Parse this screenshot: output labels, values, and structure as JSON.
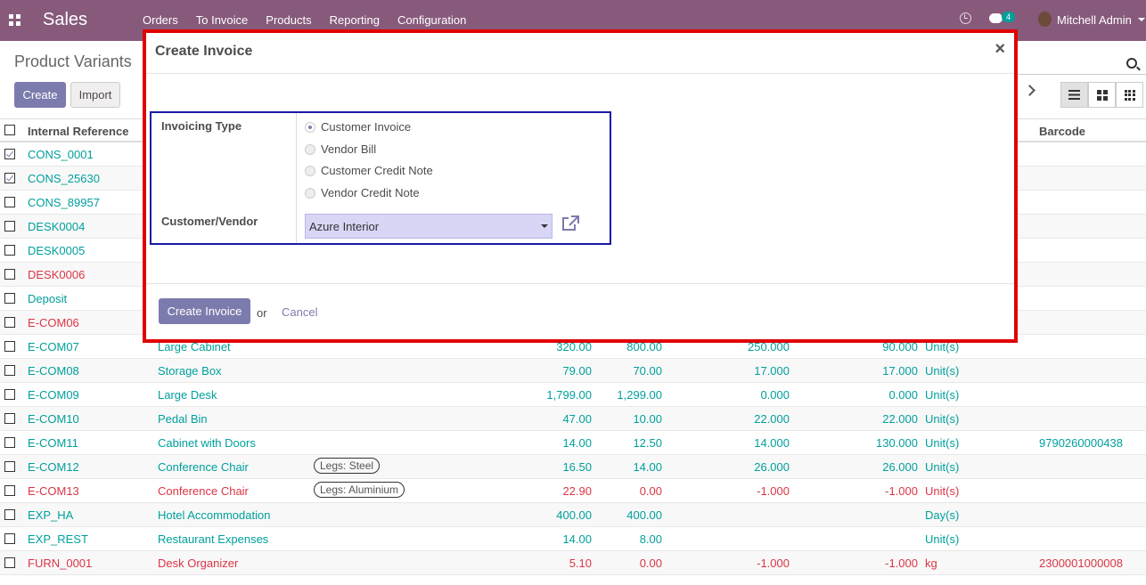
{
  "navbar": {
    "brand": "Sales",
    "menu": [
      "Orders",
      "To Invoice",
      "Products",
      "Reporting",
      "Configuration"
    ],
    "chat_count": "4",
    "user": "Mitchell Admin"
  },
  "control_panel": {
    "breadcrumb": "Product Variants",
    "create_label": "Create",
    "import_label": "Import"
  },
  "table": {
    "headers": {
      "ref": "Internal Reference",
      "barcode": "Barcode"
    },
    "rows": [
      {
        "ref": "CONS_0001",
        "name": "",
        "variant": "",
        "price": "",
        "cost": "",
        "onhand": "",
        "forecast": "",
        "uom": "",
        "barcode": "",
        "checked": true,
        "red": false
      },
      {
        "ref": "CONS_25630",
        "name": "",
        "variant": "",
        "price": "",
        "cost": "",
        "onhand": "",
        "forecast": "",
        "uom": "",
        "barcode": "",
        "checked": true,
        "red": false
      },
      {
        "ref": "CONS_89957",
        "name": "",
        "variant": "",
        "price": "",
        "cost": "",
        "onhand": "",
        "forecast": "",
        "uom": "",
        "barcode": "",
        "checked": false,
        "red": false
      },
      {
        "ref": "DESK0004",
        "name": "",
        "variant": "",
        "price": "",
        "cost": "",
        "onhand": "",
        "forecast": "",
        "uom": "",
        "barcode": "",
        "checked": false,
        "red": false
      },
      {
        "ref": "DESK0005",
        "name": "",
        "variant": "",
        "price": "",
        "cost": "",
        "onhand": "",
        "forecast": "",
        "uom": "",
        "barcode": "",
        "checked": false,
        "red": false
      },
      {
        "ref": "DESK0006",
        "name": "",
        "variant": "",
        "price": "",
        "cost": "",
        "onhand": "",
        "forecast": "",
        "uom": "",
        "barcode": "",
        "checked": false,
        "red": true
      },
      {
        "ref": "Deposit",
        "name": "",
        "variant": "",
        "price": "",
        "cost": "",
        "onhand": "",
        "forecast": "",
        "uom": "",
        "barcode": "",
        "checked": false,
        "red": false
      },
      {
        "ref": "E-COM06",
        "name": "",
        "variant": "",
        "price": "",
        "cost": "",
        "onhand": "",
        "forecast": "",
        "uom": "",
        "barcode": "",
        "checked": false,
        "red": true
      },
      {
        "ref": "E-COM07",
        "name": "Large Cabinet",
        "variant": "",
        "price": "320.00",
        "cost": "800.00",
        "onhand": "250.000",
        "forecast": "90.000",
        "uom": "Unit(s)",
        "barcode": "",
        "checked": false,
        "red": false
      },
      {
        "ref": "E-COM08",
        "name": "Storage Box",
        "variant": "",
        "price": "79.00",
        "cost": "70.00",
        "onhand": "17.000",
        "forecast": "17.000",
        "uom": "Unit(s)",
        "barcode": "",
        "checked": false,
        "red": false
      },
      {
        "ref": "E-COM09",
        "name": "Large Desk",
        "variant": "",
        "price": "1,799.00",
        "cost": "1,299.00",
        "onhand": "0.000",
        "forecast": "0.000",
        "uom": "Unit(s)",
        "barcode": "",
        "checked": false,
        "red": false
      },
      {
        "ref": "E-COM10",
        "name": "Pedal Bin",
        "variant": "",
        "price": "47.00",
        "cost": "10.00",
        "onhand": "22.000",
        "forecast": "22.000",
        "uom": "Unit(s)",
        "barcode": "",
        "checked": false,
        "red": false
      },
      {
        "ref": "E-COM11",
        "name": "Cabinet with Doors",
        "variant": "",
        "price": "14.00",
        "cost": "12.50",
        "onhand": "14.000",
        "forecast": "130.000",
        "uom": "Unit(s)",
        "barcode": "9790260000438",
        "checked": false,
        "red": false
      },
      {
        "ref": "E-COM12",
        "name": "Conference Chair",
        "variant": "Legs: Steel",
        "price": "16.50",
        "cost": "14.00",
        "onhand": "26.000",
        "forecast": "26.000",
        "uom": "Unit(s)",
        "barcode": "",
        "checked": false,
        "red": false
      },
      {
        "ref": "E-COM13",
        "name": "Conference Chair",
        "variant": "Legs: Aluminium",
        "price": "22.90",
        "cost": "0.00",
        "onhand": "-1.000",
        "forecast": "-1.000",
        "uom": "Unit(s)",
        "barcode": "",
        "checked": false,
        "red": true
      },
      {
        "ref": "EXP_HA",
        "name": "Hotel Accommodation",
        "variant": "",
        "price": "400.00",
        "cost": "400.00",
        "onhand": "",
        "forecast": "",
        "uom": "Day(s)",
        "barcode": "",
        "checked": false,
        "red": false
      },
      {
        "ref": "EXP_REST",
        "name": "Restaurant Expenses",
        "variant": "",
        "price": "14.00",
        "cost": "8.00",
        "onhand": "",
        "forecast": "",
        "uom": "Unit(s)",
        "barcode": "",
        "checked": false,
        "red": false
      },
      {
        "ref": "FURN_0001",
        "name": "Desk Organizer",
        "variant": "",
        "price": "5.10",
        "cost": "0.00",
        "onhand": "-1.000",
        "forecast": "-1.000",
        "uom": "kg",
        "barcode": "2300001000008",
        "checked": false,
        "red": true
      }
    ]
  },
  "modal": {
    "title": "Create Invoice",
    "close_glyph": "×",
    "invoicing_type_label": "Invoicing Type",
    "invoicing_options": [
      "Customer Invoice",
      "Vendor Bill",
      "Customer Credit Note",
      "Vendor Credit Note"
    ],
    "selected_option_index": 0,
    "customer_label": "Customer/Vendor",
    "customer_value": "Azure Interior",
    "create_button": "Create Invoice",
    "or_text": "or",
    "cancel_label": "Cancel"
  },
  "colors": {
    "navbar": "#875a7b",
    "primary": "#7c7bad",
    "link": "#00a09d",
    "danger": "#dc3545",
    "highlight_border": "#e10000",
    "form_border": "#1a1aa6"
  }
}
